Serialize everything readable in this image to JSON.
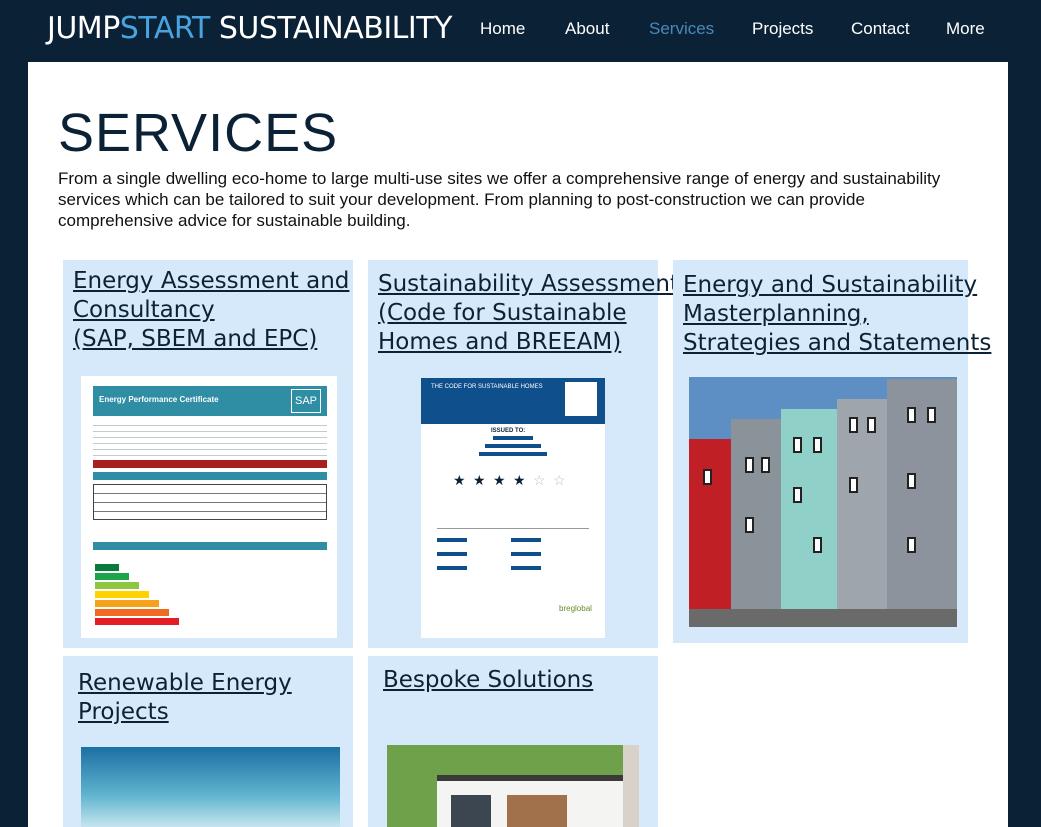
{
  "header": {
    "logo_part1": "JUMP",
    "logo_part2": "START",
    "logo_part3": " SUSTAINABILITY",
    "nav": [
      "Home",
      "About",
      "Services",
      "Projects",
      "Contact",
      "More"
    ],
    "active_nav": "Services"
  },
  "main": {
    "title": "SERVICES",
    "intro": "From a single dwelling eco-home to large multi-use sites we offer a comprehensive range of energy and sustainability services which can be tailored to suit your development. From planning to post-construction we can provide comprehensive advice for sustainable building."
  },
  "cards": [
    {
      "lines": [
        "Energy Assessment and",
        "Consultancy",
        "(SAP, SBEM and EPC)"
      ]
    },
    {
      "lines": [
        "Sustainability Assessment",
        "(Code for Sustainable",
        "Homes and BREEAM)"
      ]
    },
    {
      "lines": [
        "Energy and Sustainability",
        "Masterplanning,",
        "Strategies and Statements"
      ]
    },
    {
      "lines": [
        "Renewable Energy",
        "Projects"
      ]
    },
    {
      "lines": [
        "Bespoke Solutions"
      ]
    }
  ],
  "epc": {
    "heading": "Energy Performance Certificate",
    "badge": "SAP"
  },
  "csh": {
    "heading": "THE CODE FOR SUSTAINABLE HOMES",
    "issued": "ISSUED TO:",
    "footer": "breglobal",
    "stars_on": 4,
    "stars_total": 6
  },
  "colors": {
    "header_bg": "#0b2236",
    "accent": "#4aa3df",
    "card_bg": "#d6e9fb",
    "active_nav": "#4b88b8"
  }
}
